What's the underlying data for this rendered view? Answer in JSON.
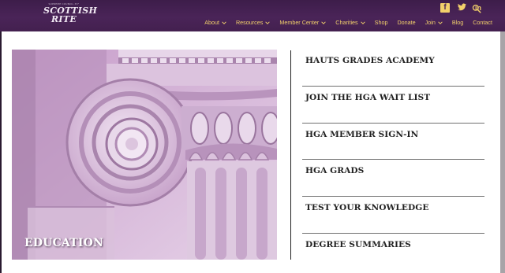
{
  "header": {
    "logo": {
      "tagline": "SUPREME COUNCIL 33°",
      "line1": "SCOTTISH",
      "line2": "RITE"
    },
    "social": [
      {
        "name": "facebook-icon",
        "glyph": "f"
      },
      {
        "name": "twitter-icon",
        "glyph": "🐦"
      },
      {
        "name": "linkedin-icon",
        "glyph": "in"
      }
    ],
    "nav": [
      {
        "label": "About",
        "dropdown": true
      },
      {
        "label": "Resources",
        "dropdown": true
      },
      {
        "label": "Member Center",
        "dropdown": true
      },
      {
        "label": "Charities",
        "dropdown": true
      },
      {
        "label": "Shop",
        "dropdown": false
      },
      {
        "label": "Donate",
        "dropdown": false
      },
      {
        "label": "Join",
        "dropdown": true
      },
      {
        "label": "Blog",
        "dropdown": false
      },
      {
        "label": "Contact",
        "dropdown": false
      }
    ]
  },
  "hero": {
    "caption": "EDUCATION"
  },
  "menu": [
    "HAUTS GRADES ACADEMY",
    "JOIN THE HGA WAIT LIST",
    "HGA MEMBER SIGN-IN",
    "HGA GRADS",
    "TEST YOUR KNOWLEDGE",
    "DEGREE SUMMARIES"
  ],
  "colors": {
    "header_bg": "#4a2458",
    "nav_text": "#f2d06b",
    "hero_tint": "#d6b7d8",
    "menu_text": "#222222"
  }
}
